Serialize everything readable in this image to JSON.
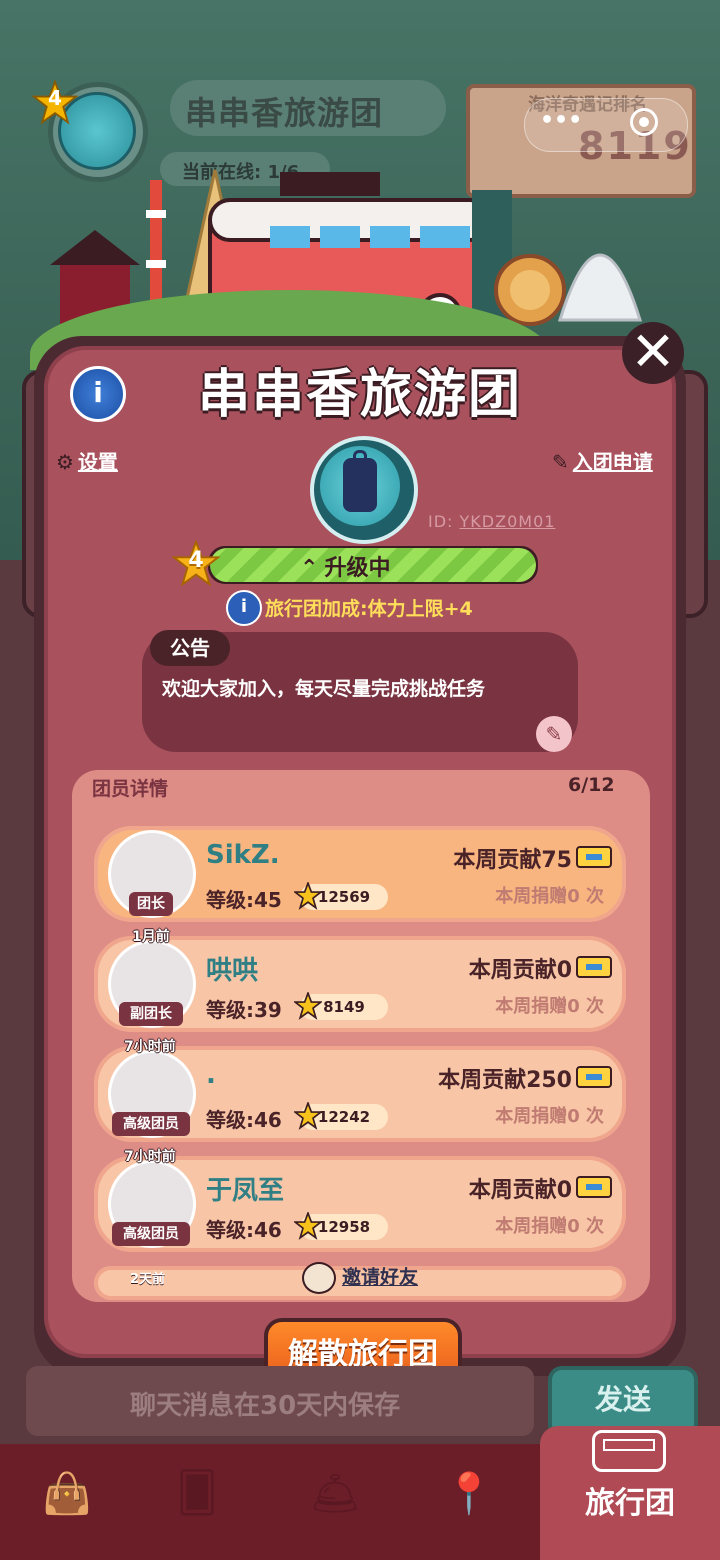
{
  "background": {
    "team_level": "4",
    "team_name": "串串香旅游团",
    "online_label": "当前在线: 1/6",
    "rank_title": "海洋奇遇记排名",
    "rank_value": "8119",
    "capsule_dots": "•••"
  },
  "panel": {
    "title": "串串香旅游团",
    "info_icon": "i",
    "close_icon": "✕",
    "settings_label": "设置",
    "apply_label": "入团申请",
    "id_prefix": "ID:",
    "id_value": "YKDZ0M01",
    "level_number": "4",
    "level_status": "升级中",
    "level_progress": 1.0,
    "bonus_text": "旅行团加成:体力上限+4",
    "notice_label": "公告",
    "notice_text": "欢迎大家加入，每天尽量完成挑战任务",
    "members_label": "团员详情",
    "members_count": "6/12",
    "invite_label": "邀请好友",
    "partial_time": "2天前",
    "disband_label": "解散旅行团"
  },
  "members": [
    {
      "name": "SikZ.",
      "role": "团长",
      "time": "",
      "level": "等级:45",
      "points": "12569",
      "contribution": "本周贡献75",
      "donation": "本周捐赠0 次"
    },
    {
      "name": "哄哄",
      "role": "副团长",
      "time": "1月前",
      "level": "等级:39",
      "points": "8149",
      "contribution": "本周贡献0",
      "donation": "本周捐赠0 次"
    },
    {
      "name": ".",
      "role": "高级团员",
      "time": "7小时前",
      "level": "等级:46",
      "points": "12242",
      "contribution": "本周贡献250",
      "donation": "本周捐赠0 次"
    },
    {
      "name": "于凤至",
      "role": "高级团员",
      "time": "7小时前",
      "level": "等级:46",
      "points": "12958",
      "contribution": "本周贡献0",
      "donation": "本周捐赠0 次"
    }
  ],
  "chat": {
    "placeholder": "聊天消息在30天内保存",
    "send_label": "发送"
  },
  "tabs": [
    {
      "name": "bag",
      "icon": "bag-icon"
    },
    {
      "name": "cards",
      "icon": "cards-icon"
    },
    {
      "name": "service",
      "icon": "bell-icon"
    },
    {
      "name": "map",
      "icon": "map-pin-icon"
    },
    {
      "name": "travel-group",
      "label": "旅行团",
      "icon": "bus-icon",
      "active": true
    }
  ],
  "colors": {
    "panel_bg": "#a9525e",
    "accent_orange": "#e4561a",
    "level_green": "#9be15a",
    "bonus_yellow": "#ffde59",
    "name_teal": "#2f7f85"
  }
}
